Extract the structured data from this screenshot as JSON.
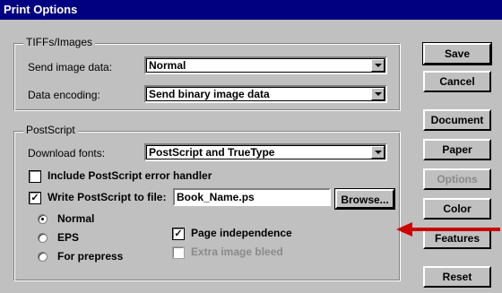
{
  "window": {
    "title": "Print Options"
  },
  "tiffs": {
    "group_label": "TIFFs/Images",
    "send_label": "Send image data:",
    "send_value": "Normal",
    "encoding_label": "Data encoding:",
    "encoding_value": "Send binary image data"
  },
  "postscript": {
    "group_label": "PostScript",
    "fonts_label": "Download fonts:",
    "fonts_value": "PostScript and TrueType",
    "error_handler_label": "Include PostScript error handler",
    "error_handler_checked": false,
    "write_file_label": "Write PostScript to file:",
    "write_file_checked": true,
    "file_value": "Book_Name.ps",
    "browse_label": "Browse...",
    "radios": [
      {
        "label": "Normal",
        "selected": true
      },
      {
        "label": "EPS",
        "selected": false
      },
      {
        "label": "For prepress",
        "selected": false
      }
    ],
    "page_independence_label": "Page independence",
    "page_independence_checked": true,
    "extra_bleed_label": "Extra image bleed",
    "extra_bleed_checked": false
  },
  "buttons": {
    "save": "Save",
    "cancel": "Cancel",
    "document": "Document",
    "paper": "Paper",
    "options": "Options",
    "color": "Color",
    "features": "Features",
    "reset": "Reset"
  },
  "colors": {
    "title_bar": "#000080",
    "dialog_bg": "#c0c0c0",
    "arrow": "#cc0000"
  },
  "annotation": {
    "icon": "red-arrow-icon"
  }
}
